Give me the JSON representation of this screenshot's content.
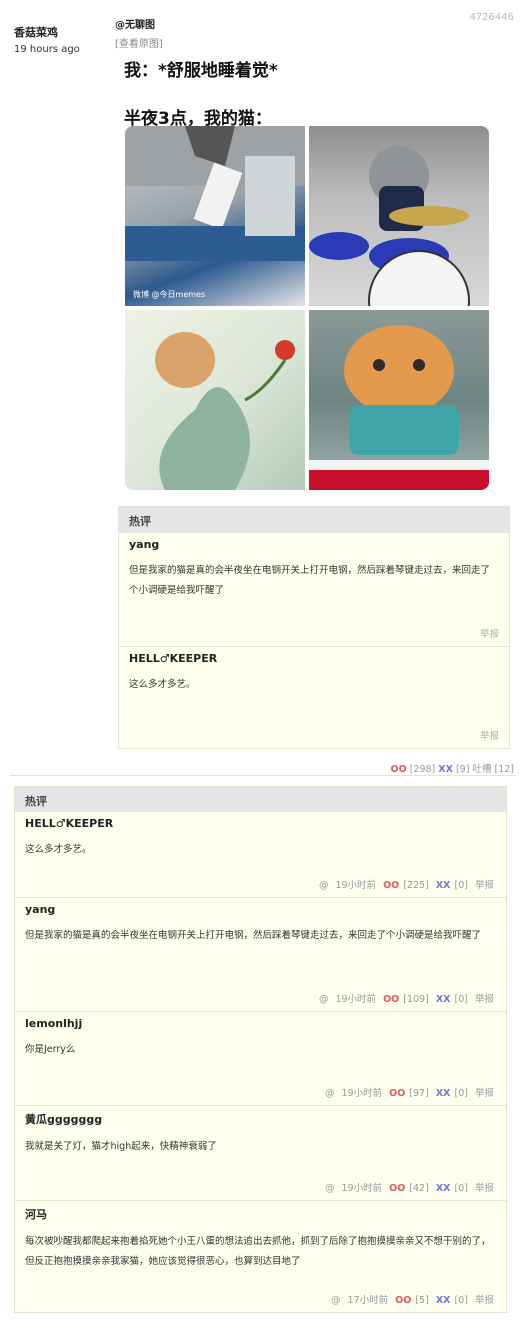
{
  "post": {
    "id": "4726446",
    "author": "香菇菜鸡",
    "time": "19 hours ago",
    "tag": "@无聊图",
    "view_original": "[查看原图]",
    "meme": {
      "caption1": "我：*舒服地睡着觉*",
      "caption2": "半夜3点，我的猫："
    },
    "footer": {
      "oo": "OO",
      "oo_count": "[298]",
      "xx": "XX",
      "xx_count": "[9]",
      "tucao": "吐槽 [12]"
    }
  },
  "hot_inline": {
    "header": "热评",
    "items": [
      {
        "name": "yang",
        "text": "但是我家的猫是真的会半夜坐在电钢开关上打开电钢，然后踩着琴键走过去，来回走了个小调硬是给我吓醒了",
        "report": "举报"
      },
      {
        "name": "HELL♂KEEPER",
        "text": "这么多才多艺。",
        "report": "举报"
      }
    ]
  },
  "hot_comments": {
    "header": "热评",
    "items": [
      {
        "name": "HELL♂KEEPER",
        "text": "这么多才多艺。",
        "at": "@",
        "time": "19小时前",
        "oo": "OO",
        "oo_count": "[225]",
        "xx": "XX",
        "xx_count": "[0]",
        "report": "举报"
      },
      {
        "name": "yang",
        "text": "但是我家的猫是真的会半夜坐在电钢开关上打开电钢，然后踩着琴键走过去，来回走了个小调硬是给我吓醒了",
        "at": "@",
        "time": "19小时前",
        "oo": "OO",
        "oo_count": "[109]",
        "xx": "XX",
        "xx_count": "[0]",
        "report": "举报"
      },
      {
        "name": "lemonlhjj",
        "text": "你是Jerry么",
        "at": "@",
        "time": "19小时前",
        "oo": "OO",
        "oo_count": "[97]",
        "xx": "XX",
        "xx_count": "[0]",
        "report": "举报"
      },
      {
        "name": "黄瓜ggggggg",
        "text": "我就是关了灯，猫才high起来，快精神衰弱了",
        "at": "@",
        "time": "19小时前",
        "oo": "OO",
        "oo_count": "[42]",
        "xx": "XX",
        "xx_count": "[0]",
        "report": "举报"
      },
      {
        "name": "河马",
        "text": "每次被吵醒我都爬起来抱着掐死她个小王八蛋的想法追出去抓他，抓到了后除了抱抱摸摸亲亲又不想干别的了，但反正抱抱摸摸亲亲我家猫，她应该觉得很恶心，也算到达目地了",
        "at": "@",
        "time": "17小时前",
        "oo": "OO",
        "oo_count": "[5]",
        "xx": "XX",
        "xx_count": "[0]",
        "report": "举报"
      }
    ]
  },
  "colors": {
    "oo": "#e05c5c",
    "xx": "#6b7bd6",
    "comment_bg": "#fffff0",
    "header_bg": "#e6e6e6"
  },
  "watermark": "微博 @今日memes"
}
